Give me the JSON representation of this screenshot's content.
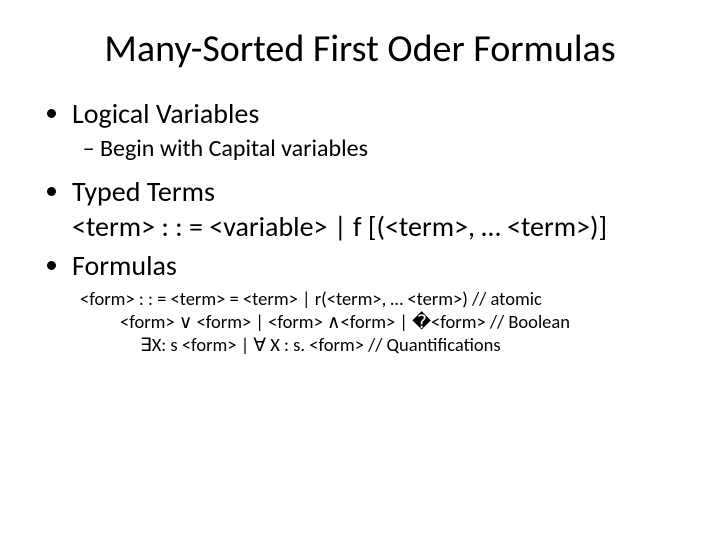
{
  "title": "Many-Sorted First Oder Formulas",
  "bullets": {
    "b1": "Logical Variables",
    "b1_sub": "Begin with Capital variables",
    "b2": "Typed Terms",
    "b2_line": "<term> : : = <variable> | f [(<term>, … <term>)]",
    "b3": "Formulas"
  },
  "syntax": {
    "line1": "<form> : : = <term> = <term> | r(<term>, … <term>) // atomic",
    "line2": "<form> ∨ <form> | <form> ∧<form> | �<form> // Boolean",
    "line3": "∃X: s <form> | ∀ X : s. <form> // Quantifications"
  }
}
